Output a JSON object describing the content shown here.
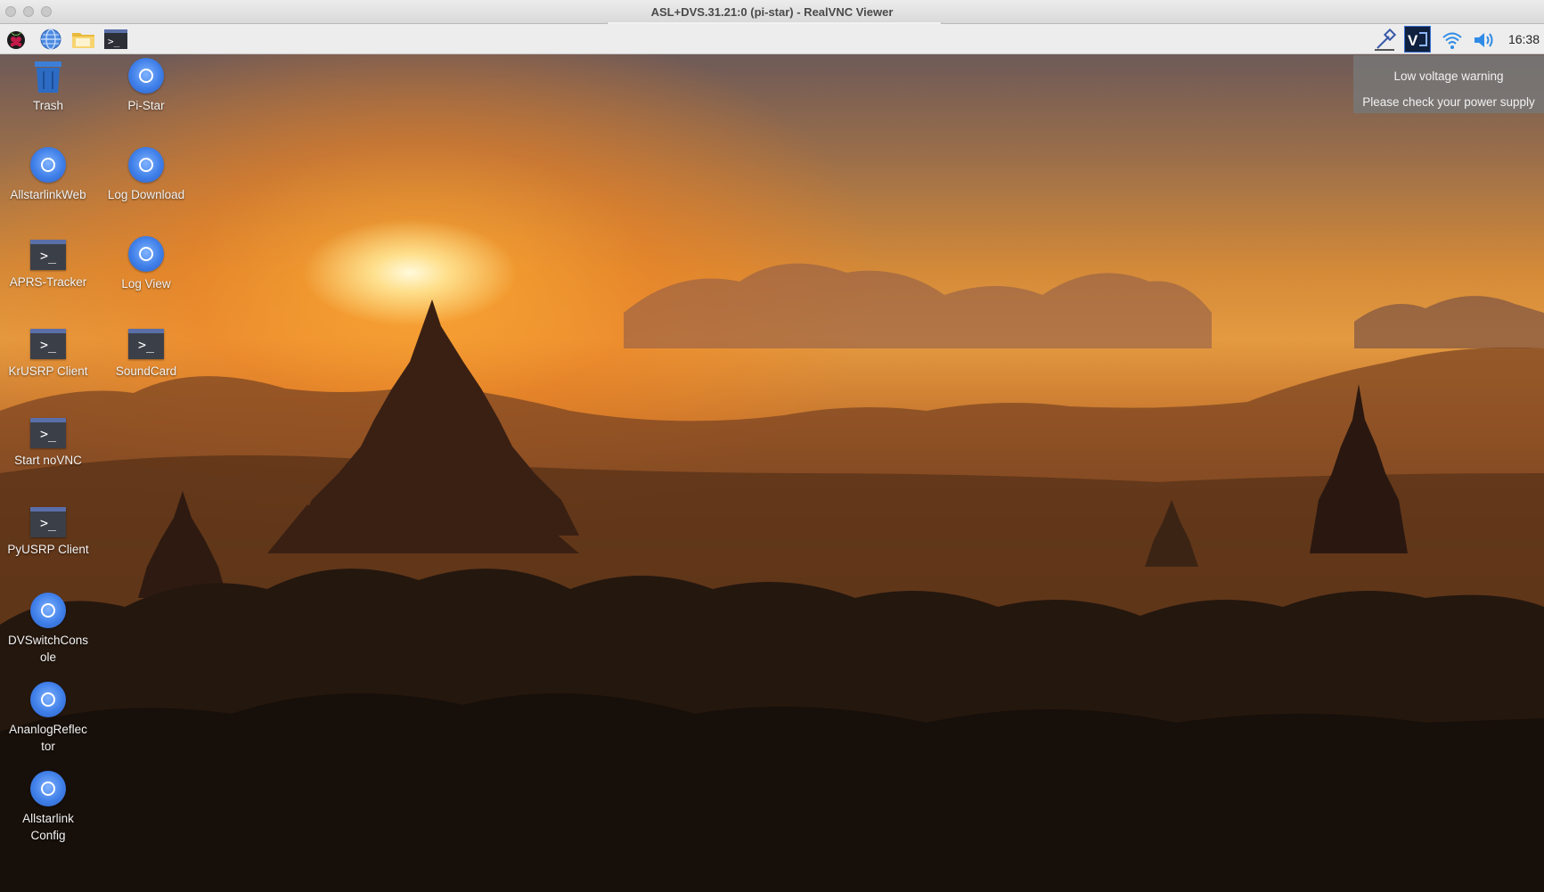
{
  "window": {
    "title": "ASL+DVS.31.21:0 (pi-star) - RealVNC Viewer"
  },
  "taskbar": {
    "launchers": [
      {
        "name": "raspberry-menu-icon"
      },
      {
        "name": "web-browser-icon"
      },
      {
        "name": "file-manager-icon"
      },
      {
        "name": "terminal-icon"
      }
    ],
    "tray": {
      "clock": "16:38"
    }
  },
  "desktop_icons": [
    {
      "label": "Trash",
      "type": "trash"
    },
    {
      "label": "Pi-Star",
      "type": "chromium"
    },
    {
      "label": "AllstarlinkWeb",
      "type": "chromium"
    },
    {
      "label": "Log Download",
      "type": "chromium"
    },
    {
      "label": "APRS-Tracker",
      "type": "terminal"
    },
    {
      "label": "Log View",
      "type": "chromium"
    },
    {
      "label": "KrUSRP Client",
      "type": "terminal"
    },
    {
      "label": "SoundCard",
      "type": "terminal"
    },
    {
      "label": "Start noVNC",
      "type": "terminal"
    },
    {
      "label": "PyUSRP Client",
      "type": "terminal"
    },
    {
      "label": "DVSwitchCons\nole",
      "type": "chromium"
    },
    {
      "label": "AnanlogReflec\ntor",
      "type": "chromium"
    },
    {
      "label": "Allstarlink\nConfig",
      "type": "chromium"
    }
  ],
  "notification": {
    "title": "Low voltage warning",
    "message": "Please check your power supply"
  },
  "colors": {
    "accent_blue": "#3f7fe8",
    "taskbar": "#ededed"
  }
}
